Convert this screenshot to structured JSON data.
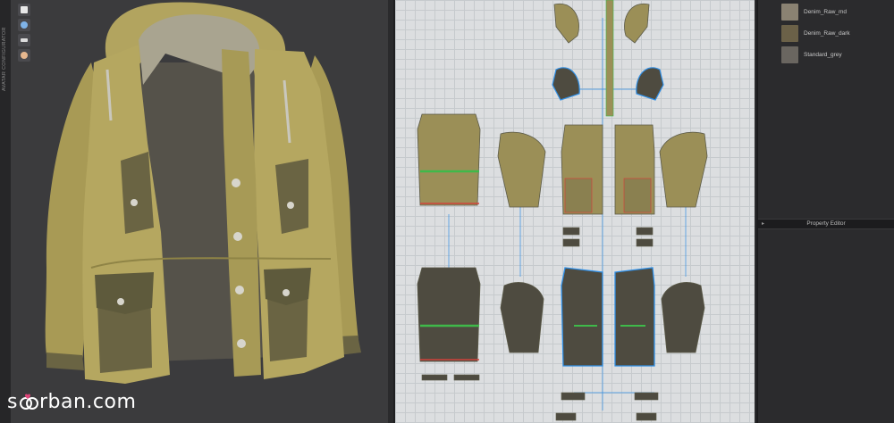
{
  "viewport": {
    "strip_label": "AVATAR CONFIGURATOR",
    "tools": [
      {
        "icon": "garment-icon",
        "color": "#e8e8e8"
      },
      {
        "icon": "brush-icon",
        "color": "#7fb3e8"
      },
      {
        "icon": "hanger-icon",
        "color": "#dddddd"
      },
      {
        "icon": "avatar-icon",
        "color": "#e6b78e"
      }
    ]
  },
  "fabrics": [
    {
      "name": "Denim_Raw_md",
      "color": "#8a8272"
    },
    {
      "name": "Denim_Raw_dark",
      "color": "#6b6148"
    },
    {
      "name": "Standard_grey",
      "color": "#6a6660"
    }
  ],
  "property_editor": {
    "title": "Property Editor",
    "collapse_glyph": "▸"
  },
  "watermark": {
    "prefix": "s",
    "suffix": "rban.com"
  },
  "colors": {
    "jacket": "#b5a760",
    "jacket_shadow": "#8f8446",
    "pocket": "#6a6443",
    "lining": "#55524a",
    "hood_lining": "#a9a490",
    "pattern_khaki": "#9b8f57",
    "pattern_dark": "#4e4b40",
    "seam_green": "#3fb94a",
    "seam_red": "#d0433b",
    "selected_blue": "#2f8fe6"
  }
}
